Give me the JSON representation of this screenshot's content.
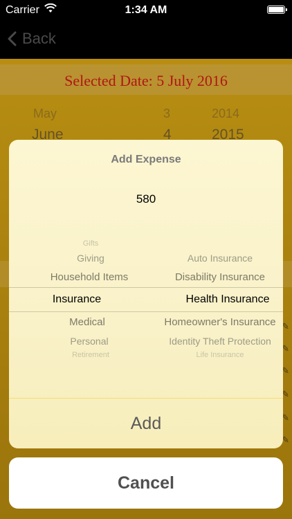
{
  "status_bar": {
    "carrier": "Carrier",
    "time": "1:34 AM"
  },
  "nav": {
    "back_label": "Back"
  },
  "background": {
    "selected_date": "Selected Date: 5 July 2016",
    "date_picker": {
      "months": [
        "May",
        "June"
      ],
      "days": [
        "3",
        "4"
      ],
      "years": [
        "2014",
        "2015"
      ]
    }
  },
  "sheet": {
    "title": "Add Expense",
    "amount": "580",
    "category_picker": {
      "categories": [
        "Gifts",
        "Giving",
        "Household Items",
        "Insurance",
        "Medical",
        "Personal",
        "Retirement"
      ],
      "subcategories": [
        "Auto Insurance",
        "Disability Insurance",
        "Health Insurance",
        "Homeowner's Insurance",
        "Identity Theft Protection",
        "Life Insurance"
      ],
      "selected_category": "Insurance",
      "selected_subcategory": "Health Insurance"
    },
    "add_label": "Add"
  },
  "cancel_label": "Cancel"
}
